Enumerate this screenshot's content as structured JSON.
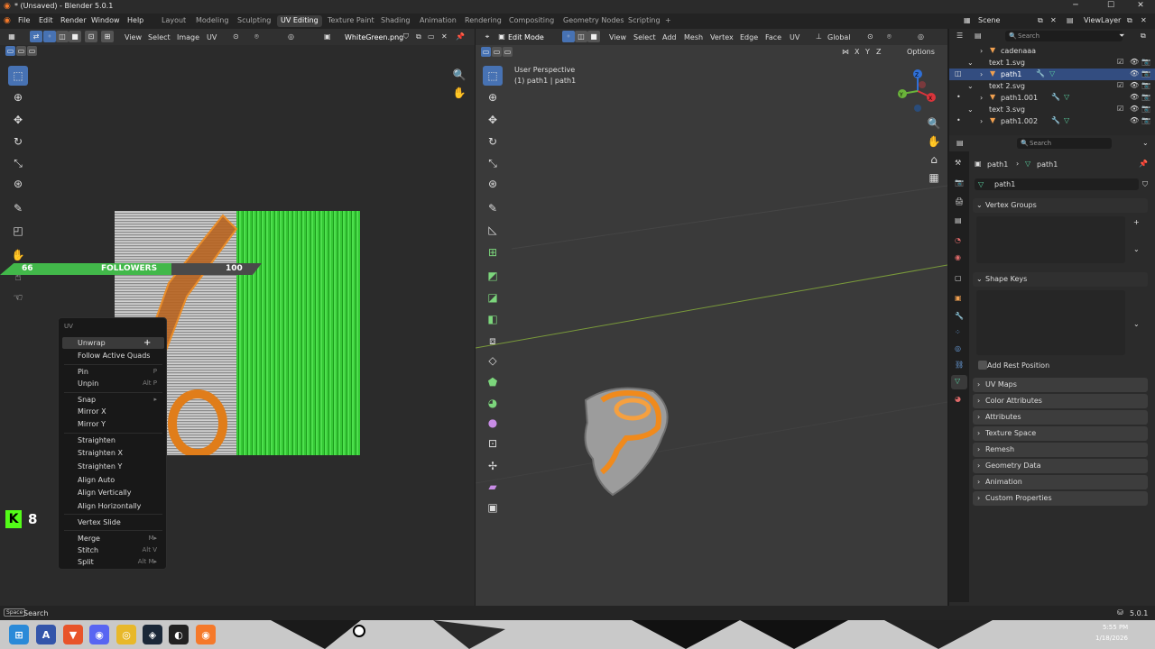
{
  "window": {
    "title": "* (Unsaved) - Blender 5.0.1",
    "min": "─",
    "max": "☐",
    "close": "✕"
  },
  "menubar": {
    "items": [
      "File",
      "Edit",
      "Render",
      "Window",
      "Help"
    ],
    "workspaces": [
      "Layout",
      "Modeling",
      "Sculpting",
      "UV Editing",
      "Texture Paint",
      "Shading",
      "Animation",
      "Rendering",
      "Compositing",
      "Geometry Nodes",
      "Scripting"
    ],
    "add_tab": "+",
    "scene": "Scene",
    "view_layer": "ViewLayer"
  },
  "uv_editor": {
    "menus": [
      "View",
      "Select",
      "Image",
      "UV"
    ],
    "image_name": "WhiteGreen.png"
  },
  "overlay_banner": {
    "left_value": "66",
    "label": "FOLLOWERS",
    "right_value": "100"
  },
  "brand_badge": {
    "letter": "K",
    "number": "8"
  },
  "context_menu": {
    "title": "UV",
    "items": [
      {
        "label": "Unwrap",
        "key": ""
      },
      {
        "label": "Follow Active Quads",
        "key": ""
      },
      {
        "label": "Pin",
        "key": "P"
      },
      {
        "label": "Unpin",
        "key": "Alt P"
      },
      {
        "label": "Snap",
        "key": "▸"
      },
      {
        "label": "Mirror X",
        "key": ""
      },
      {
        "label": "Mirror Y",
        "key": ""
      },
      {
        "label": "Straighten",
        "key": ""
      },
      {
        "label": "Straighten X",
        "key": ""
      },
      {
        "label": "Straighten Y",
        "key": ""
      },
      {
        "label": "Align Auto",
        "key": ""
      },
      {
        "label": "Align Vertically",
        "key": ""
      },
      {
        "label": "Align Horizontally",
        "key": ""
      },
      {
        "label": "Vertex Slide",
        "key": ""
      },
      {
        "label": "Merge",
        "key": "M▸"
      },
      {
        "label": "Stitch",
        "key": "Alt V"
      },
      {
        "label": "Split",
        "key": "Alt M▸"
      }
    ]
  },
  "viewport": {
    "mode": "Edit Mode",
    "menus": [
      "View",
      "Select",
      "Add",
      "Mesh",
      "Vertex",
      "Edge",
      "Face",
      "UV"
    ],
    "orientation": "Global",
    "axes": [
      "X",
      "Y",
      "Z"
    ],
    "options": "Options",
    "info_line1": "User Perspective",
    "info_line2": "(1) path1 | path1",
    "gizmo": {
      "x": "X",
      "y": "Y",
      "z": "Z"
    }
  },
  "outliner": {
    "search_placeholder": "Search",
    "rows": [
      "cadenaaa",
      "text 1.svg",
      "path1",
      "text 2.svg",
      "path1.001",
      "text 3.svg",
      "path1.002"
    ]
  },
  "properties": {
    "search_placeholder": "Search",
    "breadcrumb": [
      "path1",
      "path1"
    ],
    "data_name": "path1",
    "panels_open": [
      "Vertex Groups",
      "Shape Keys"
    ],
    "checkbox": "Add Rest Position",
    "panels_closed": [
      "UV Maps",
      "Color Attributes",
      "Attributes",
      "Texture Space",
      "Remesh",
      "Geometry Data",
      "Animation",
      "Custom Properties"
    ]
  },
  "statusbar": {
    "key": "Space",
    "action": "Search",
    "version": "5.0.1"
  },
  "taskbar": {
    "time": "5:55 PM",
    "date": "1/18/2026"
  },
  "colors": {
    "accent": "#4772b3",
    "selection": "#334d80",
    "orange": "#f08a1c",
    "green": "#3cd63c"
  }
}
